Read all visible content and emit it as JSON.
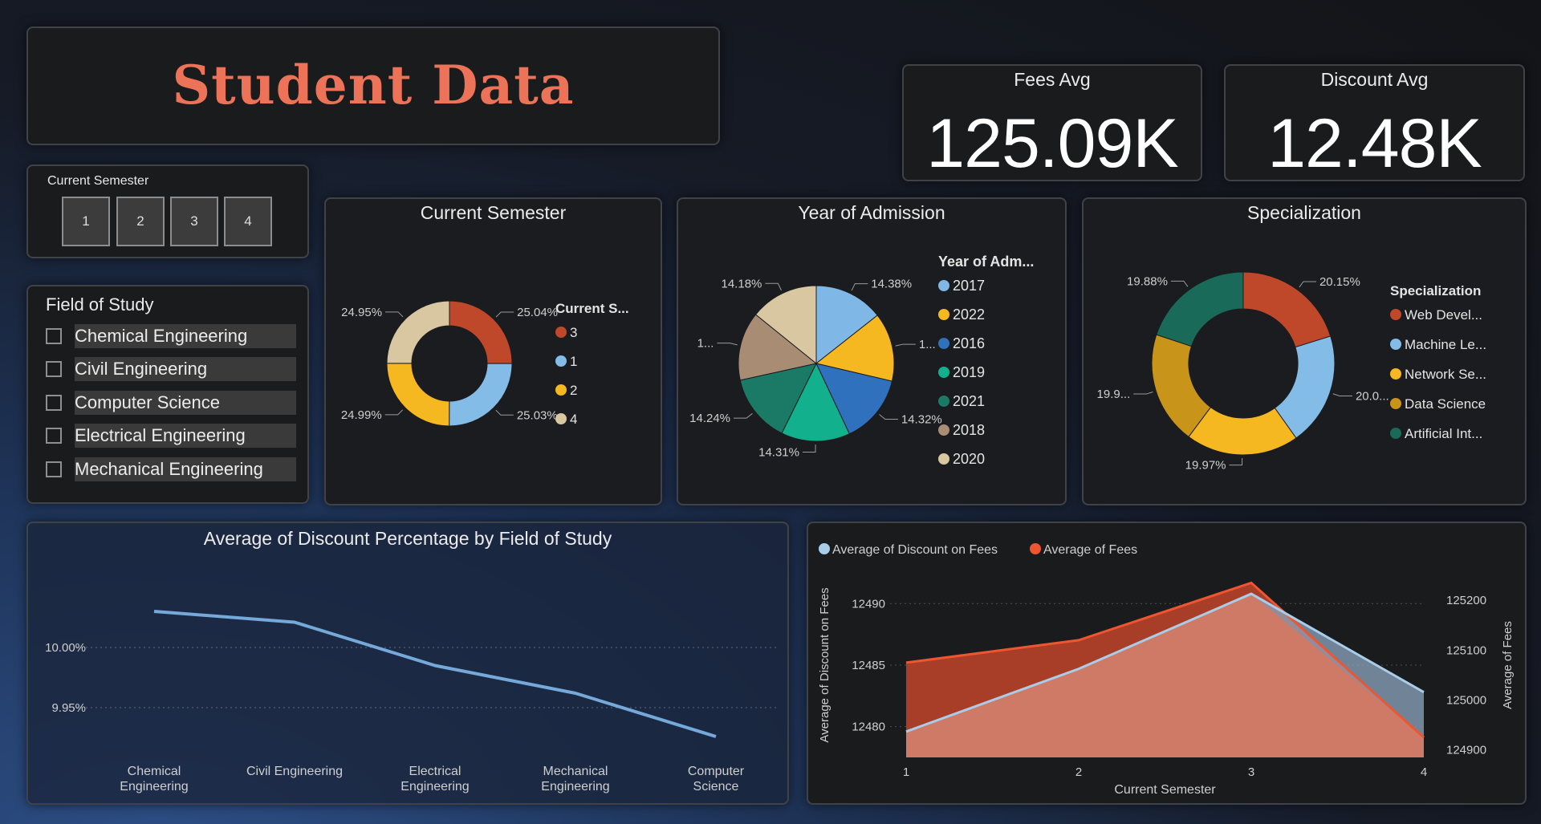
{
  "header": {
    "title": "Student Data"
  },
  "kpis": [
    {
      "label": "Fees Avg",
      "value": "125.09K"
    },
    {
      "label": "Discount Avg",
      "value": "12.48K"
    }
  ],
  "semester_slicer": {
    "title": "Current Semester",
    "options": [
      "1",
      "2",
      "3",
      "4"
    ]
  },
  "field_slicer": {
    "title": "Field of Study",
    "options": [
      "Chemical Engineering",
      "Civil Engineering",
      "Computer Science",
      "Electrical Engineering",
      "Mechanical Engineering"
    ]
  },
  "chart_data": [
    {
      "type": "pie",
      "variant": "donut",
      "title": "Current Semester",
      "legend_title": "Current S...",
      "legend_position": "right",
      "slices": [
        {
          "label": "3",
          "value": 25.04,
          "display": "25.04%",
          "color": "#c0482a"
        },
        {
          "label": "1",
          "value": 25.03,
          "display": "25.03%",
          "color": "#84bce8"
        },
        {
          "label": "2",
          "value": 24.99,
          "display": "24.99%",
          "color": "#f6b820"
        },
        {
          "label": "4",
          "value": 24.95,
          "display": "24.95%",
          "color": "#d9c7a1"
        }
      ]
    },
    {
      "type": "pie",
      "title": "Year of Admission",
      "legend_title": "Year of Adm...",
      "legend_position": "right",
      "slices": [
        {
          "label": "2017",
          "value": 14.38,
          "display": "14.38%",
          "color": "#7fb8e6"
        },
        {
          "label": "2022",
          "value": 14.29,
          "display": "1...",
          "color": "#f6b820"
        },
        {
          "label": "2016",
          "value": 14.32,
          "display": "14.32%",
          "color": "#2f71bd"
        },
        {
          "label": "2019",
          "value": 14.31,
          "display": "14.31%",
          "color": "#13b08e"
        },
        {
          "label": "2021",
          "value": 14.24,
          "display": "14.24%",
          "color": "#1a7a66"
        },
        {
          "label": "2018",
          "value": 14.28,
          "display": "1...",
          "color": "#a88d74"
        },
        {
          "label": "2020",
          "value": 14.18,
          "display": "14.18%",
          "color": "#d9c7a1"
        }
      ]
    },
    {
      "type": "pie",
      "variant": "donut",
      "title": "Specialization",
      "legend_title": "Specialization",
      "legend_position": "right",
      "slices": [
        {
          "label": "Web Devel...",
          "value": 20.15,
          "display": "20.15%",
          "color": "#c0482a"
        },
        {
          "label": "Machine Le...",
          "value": 20.0,
          "display": "20.0...",
          "color": "#84bce8"
        },
        {
          "label": "Network Se...",
          "value": 19.97,
          "display": "19.97%",
          "color": "#f6b820"
        },
        {
          "label": "Data Science",
          "value": 19.9,
          "display": "19.9...",
          "color": "#c8951a"
        },
        {
          "label": "Artificial Int...",
          "value": 19.88,
          "display": "19.88%",
          "color": "#1a6a5a"
        }
      ]
    },
    {
      "type": "line",
      "title": "Average of Discount Percentage by Field of Study",
      "categories": [
        "Chemical Engineering",
        "Civil Engineering",
        "Electrical Engineering",
        "Mechanical Engineering",
        "Computer Science"
      ],
      "series": [
        {
          "values": [
            10.03,
            10.021,
            9.985,
            9.962,
            9.926
          ],
          "color": "#74a9da"
        }
      ],
      "y_ticks": [
        "10.00%",
        "9.95%"
      ],
      "ylim": [
        9.91,
        10.06
      ],
      "grid": true
    },
    {
      "type": "area",
      "x": [
        1,
        2,
        3,
        4
      ],
      "xlabel": "Current Semester",
      "ylabel_left": "Average of Discount on Fees",
      "ylabel_right": "Average of Fees",
      "legend_position": "top-left",
      "series": [
        {
          "name": "Average of Discount on Fees",
          "axis": "left",
          "values": [
            12479.6,
            12484.7,
            12490.8,
            12482.8
          ],
          "color": "#a9cde8"
        },
        {
          "name": "Average of Fees",
          "axis": "right",
          "values": [
            125075,
            125120,
            125235,
            124925
          ],
          "color": "#ee5530"
        }
      ],
      "ylim_left": [
        12477.5,
        12492.5
      ],
      "ylim_right": [
        124885,
        125255
      ],
      "y_ticks_left": [
        12480,
        12485,
        12490
      ],
      "y_ticks_right": [
        124900,
        125000,
        125100,
        125200
      ],
      "grid": true
    }
  ]
}
